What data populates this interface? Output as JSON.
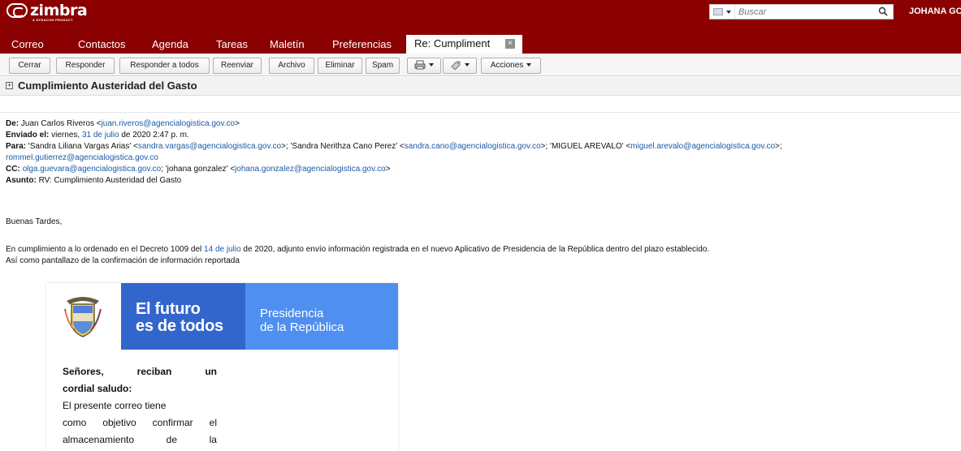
{
  "app": {
    "logo_text": "zimbra",
    "logo_sub": "A SYNACOR PRODUCT",
    "search_placeholder": "Buscar",
    "user_name": "JOHANA GO"
  },
  "tabs": [
    {
      "label": "Correo"
    },
    {
      "label": "Contactos"
    },
    {
      "label": "Agenda"
    },
    {
      "label": "Tareas"
    },
    {
      "label": "Maletín"
    },
    {
      "label": "Preferencias"
    }
  ],
  "active_tab": {
    "label": "Re: Cumpliment",
    "close_glyph": "×"
  },
  "toolbar": {
    "cerrar": "Cerrar",
    "responder": "Responder",
    "responder_todos": "Responder a todos",
    "reenviar": "Reenviar",
    "archivo": "Archivo",
    "eliminar": "Eliminar",
    "spam": "Spam",
    "acciones": "Acciones"
  },
  "subject": {
    "title": "Cumplimiento Austeridad del Gasto",
    "expand_glyph": "+"
  },
  "headers": {
    "from_label": "De:",
    "from_name": "Juan Carlos Riveros <",
    "from_email": "juan.riveros@agencialogistica.gov.co",
    "from_close": ">",
    "sent_label": "Enviado el:",
    "sent_pre": "viernes,",
    "sent_link": "31 de julio",
    "sent_post": "de 2020 2:47 p. m.",
    "to_label": "Para:",
    "to_1_name": "'Sandra Liliana Vargas Arias' <",
    "to_1_email": "sandra.vargas@agencialogistica.gov.co",
    "to_2_name": ">; 'Sandra Nerithza Cano Perez' <",
    "to_2_email": "sandra.cano@agencialogistica.gov.co",
    "to_3_name": ">; 'MIGUEL AREVALO' <",
    "to_3_email": "miguel.arevalo@agencialogistica.gov.co",
    "to_3_close": ">;",
    "to_4_email": "rommel.gutierrez@agencialogistica.gov.co",
    "cc_label": "CC:",
    "cc_1_email": "olga.guevara@agencialogistica.gov.co",
    "cc_2_name": "; 'johana gonzalez' <",
    "cc_2_email": "johana.gonzalez@agencialogistica.gov.co",
    "cc_close": ">",
    "subject_label": "Asunto:",
    "subject_value": "RV: Cumplimiento Austeridad del Gasto"
  },
  "body": {
    "greeting": "Buenas Tardes,",
    "p1_pre": "En cumplimiento a lo ordenado en el Decreto 1009 del",
    "p1_link": "14 de julio",
    "p1_post": "de 2020, adjunto envío información registrada en el nuevo Aplicativo de Presidencia de la República dentro del plazo establecido.",
    "p2": "Así como pantallazo de la confirmación de información reportada"
  },
  "embedded": {
    "banner_mid_1": "El futuro",
    "banner_mid_2": "es de todos",
    "banner_right_1": "Presidencia",
    "banner_right_2": "de la República",
    "line1_words": [
      "Señores,",
      "reciban",
      "un"
    ],
    "line2": "cordial saludo:",
    "line3": "El presente correo tiene",
    "line4_words": [
      "como",
      "objetivo",
      "confirmar",
      "el"
    ],
    "line5_words": [
      "almacenamiento",
      "de",
      "la"
    ]
  },
  "colors": {
    "brand_red": "#8b0000",
    "link_blue": "#1a5aa6",
    "banner_blue_dark": "#3366cc",
    "banner_blue_light": "#4f8fef"
  }
}
